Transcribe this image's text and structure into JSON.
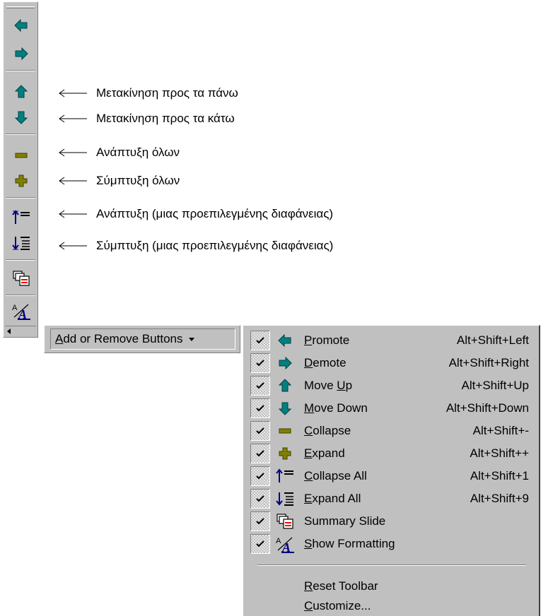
{
  "toolbar": {
    "buttons": [
      {
        "icon": "promote-arrow-left-icon"
      },
      {
        "icon": "demote-arrow-right-icon"
      },
      {
        "icon": "move-up-arrow-icon"
      },
      {
        "icon": "move-down-arrow-icon"
      },
      {
        "icon": "collapse-minus-icon"
      },
      {
        "icon": "expand-plus-icon"
      },
      {
        "icon": "collapse-all-icon"
      },
      {
        "icon": "expand-all-icon"
      },
      {
        "icon": "summary-slide-icon"
      },
      {
        "icon": "show-formatting-icon"
      }
    ]
  },
  "annotations": [
    {
      "text": "Μετακίνηση προς τα πάνω"
    },
    {
      "text": "Μετακίνηση προς τα κάτω"
    },
    {
      "text": "Ανάπτυξη όλων"
    },
    {
      "text": "Σύμπτυξη όλων"
    },
    {
      "text": "Ανάπτυξη (μιας προεπιλεγμένης διαφάνειας)"
    },
    {
      "text": "Σύμπτυξη (μιας προεπιλεγμένης διαφάνειας)"
    }
  ],
  "add_remove": {
    "label_accel": "A",
    "label_rest": "dd or Remove Buttons"
  },
  "menu": {
    "items": [
      {
        "accel": "P",
        "rest": "romote",
        "pre": "",
        "shortcut": "Alt+Shift+Left",
        "checked": true,
        "icon": "promote-arrow-left-icon"
      },
      {
        "accel": "D",
        "rest": "emote",
        "pre": "",
        "shortcut": "Alt+Shift+Right",
        "checked": true,
        "icon": "demote-arrow-right-icon"
      },
      {
        "pre": "Move ",
        "accel": "U",
        "rest": "p",
        "shortcut": "Alt+Shift+Up",
        "checked": true,
        "icon": "move-up-arrow-icon"
      },
      {
        "pre": "",
        "accel": "M",
        "rest": "ove Down",
        "shortcut": "Alt+Shift+Down",
        "checked": true,
        "icon": "move-down-arrow-icon"
      },
      {
        "pre": "",
        "accel": "C",
        "rest": "ollapse",
        "shortcut": "Alt+Shift+-",
        "checked": true,
        "icon": "collapse-minus-icon"
      },
      {
        "pre": "",
        "accel": "E",
        "rest": "xpand",
        "shortcut": "Alt+Shift++",
        "checked": true,
        "icon": "expand-plus-icon"
      },
      {
        "pre": "",
        "accel": "C",
        "rest": "ollapse All",
        "shortcut": "Alt+Shift+1",
        "checked": true,
        "icon": "collapse-all-icon"
      },
      {
        "pre": "",
        "accel": "E",
        "rest": "xpand All",
        "shortcut": "Alt+Shift+9",
        "checked": true,
        "icon": "expand-all-icon"
      },
      {
        "pre": "Summary Slide",
        "accel": "",
        "rest": "",
        "shortcut": "",
        "checked": true,
        "icon": "summary-slide-icon"
      },
      {
        "pre": "",
        "accel": "S",
        "rest": "how Formatting",
        "shortcut": "",
        "checked": true,
        "icon": "show-formatting-icon"
      }
    ],
    "reset": {
      "accel": "R",
      "rest": "eset Toolbar"
    },
    "customize": {
      "accel": "C",
      "rest": "ustomize..."
    }
  },
  "colors": {
    "arrow_teal": "#008080",
    "arrow_olive": "#808000",
    "toolbar_bg": "#c0c0c0",
    "icon_blue": "#000080",
    "icon_red": "#ff0000"
  }
}
